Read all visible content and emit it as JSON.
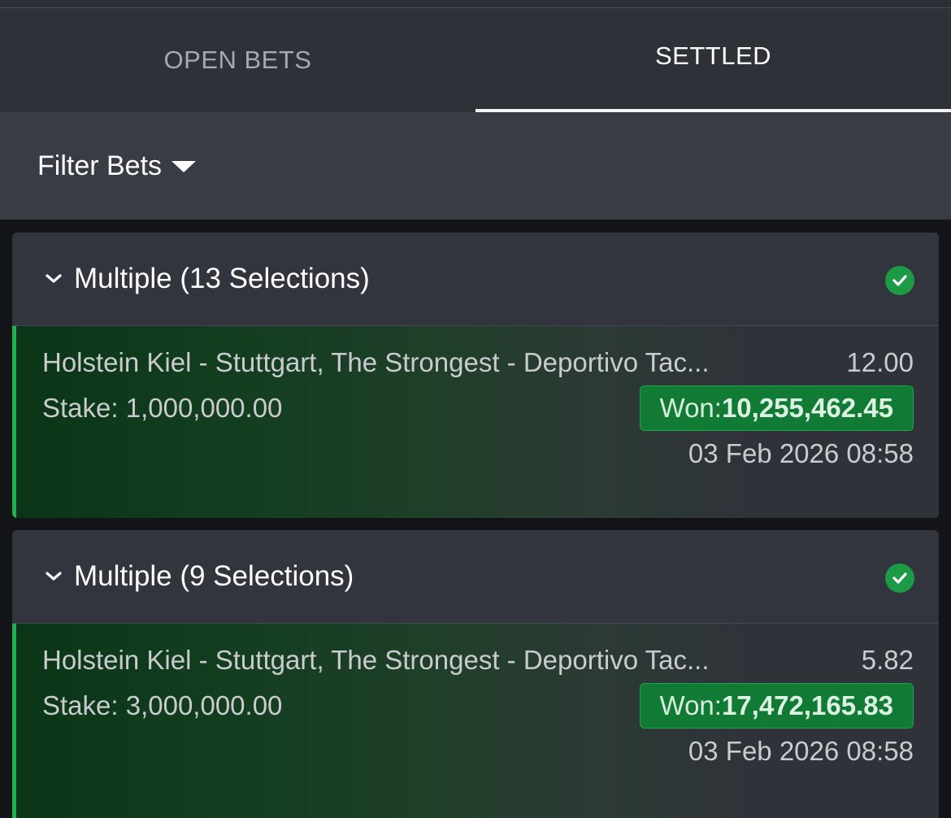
{
  "tabs": [
    {
      "label": "OPEN BETS",
      "active": false
    },
    {
      "label": "SETTLED",
      "active": true
    }
  ],
  "filter": {
    "label": "Filter Bets"
  },
  "colors": {
    "background": "#131417",
    "tab_bar": "#2f3139",
    "filter_bar": "#3a3c45",
    "card": "#30323a",
    "won_green": "#117a35",
    "accent_green": "#1fb14d",
    "check_green": "#1c9a46"
  },
  "bets": [
    {
      "title": "Multiple (13 Selections)",
      "status_icon": "check-circle-icon",
      "selections": "Holstein Kiel - Stuttgart, The Strongest - Deportivo Tac...",
      "odds": "12.00",
      "stake": "Stake: 1,000,000.00",
      "won_label": "Won: ",
      "won_amount": "10,255,462.45",
      "date": "03 Feb 2026 08:58"
    },
    {
      "title": "Multiple (9 Selections)",
      "status_icon": "check-circle-icon",
      "selections": "Holstein Kiel - Stuttgart, The Strongest - Deportivo Tac...",
      "odds": "5.82",
      "stake": "Stake: 3,000,000.00",
      "won_label": "Won: ",
      "won_amount": "17,472,165.83",
      "date": "03 Feb 2026 08:58"
    }
  ]
}
